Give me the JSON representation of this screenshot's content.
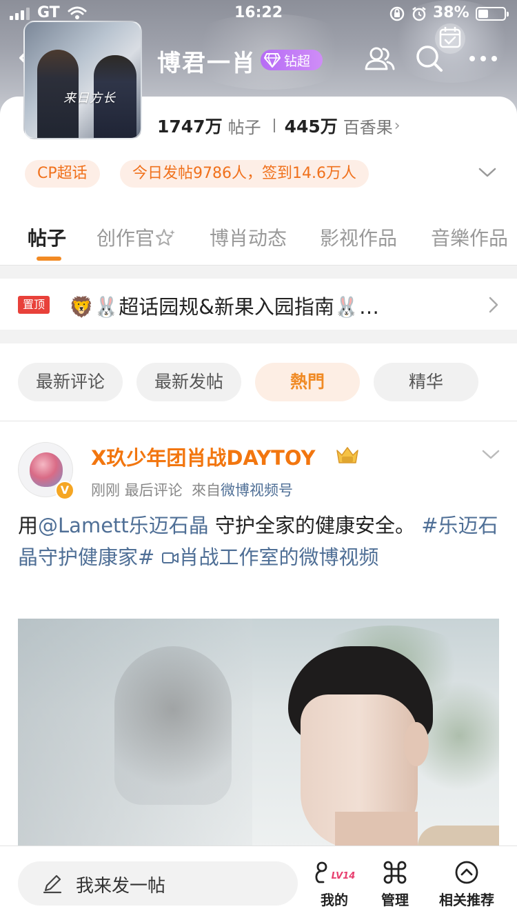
{
  "status_bar": {
    "carrier": "GT",
    "time": "16:22",
    "battery": "38%",
    "battery_level": 0.38
  },
  "header": {
    "title": "博君一肖",
    "badge_label": "钻超",
    "cover_caption": "来日方长",
    "icons": [
      "back-icon",
      "people-icon",
      "search-icon",
      "more-icon",
      "checkin-calendar-icon"
    ]
  },
  "stats": {
    "posts_count": "1747万",
    "posts_label": "帖子",
    "fans_count": "445万",
    "fans_label": "百香果",
    "chevron": "›"
  },
  "tags": {
    "cp": "CP超话",
    "daily": "今日发帖9786人，签到14.6万人"
  },
  "tabs": [
    {
      "label": "帖子",
      "active": true
    },
    {
      "label": "创作官"
    },
    {
      "label": "博肖动态"
    },
    {
      "label": "影视作品"
    },
    {
      "label": "音樂作品"
    }
  ],
  "pinned": {
    "badge": "置顶",
    "title": "🦁🐰超话园规&新果入园指南🐰…"
  },
  "filters": [
    {
      "label": "最新评论"
    },
    {
      "label": "最新发帖"
    },
    {
      "label": "熱門",
      "active": true
    },
    {
      "label": "精华"
    }
  ],
  "post": {
    "author": "X玖少年团肖战DAYTOY",
    "verified_mark": "V",
    "meta_time": "刚刚",
    "meta_last": "最后评论",
    "meta_from": "來自",
    "meta_source": "微博视频号",
    "text_prefix": "用",
    "mention": "@Lamett乐迈石晶",
    "text_mid": " 守护全家的健康安全。",
    "hashtag": "#乐迈石晶守护健康家#",
    "video_link": "肖战工作室的微博视频"
  },
  "bottom_bar": {
    "composer_placeholder": "我来发一帖",
    "my_label": "我的",
    "my_level": "LV14",
    "manage_label": "管理",
    "related_label": "相关推荐"
  },
  "colors": {
    "accent_orange": "#f2760f",
    "link_blue": "#4f6f96",
    "pin_red": "#e8413a",
    "diamond_purple": "#b66cf5"
  }
}
